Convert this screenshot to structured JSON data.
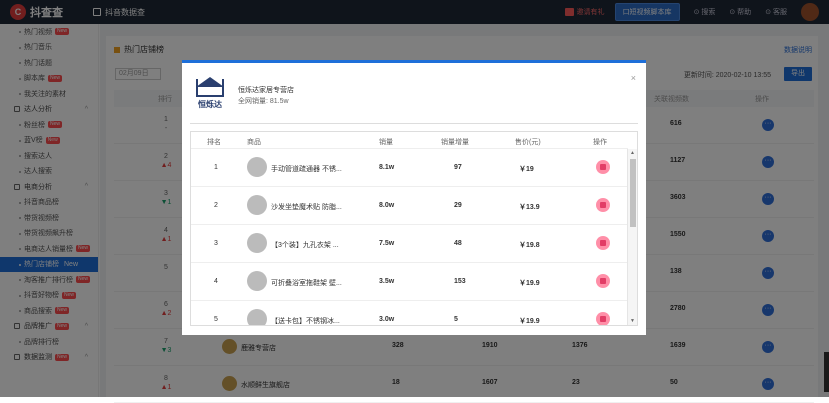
{
  "topbar": {
    "logo_badge": "C",
    "logo_text": "抖查查",
    "app_name": "抖音数据查",
    "invite": "邀请有礼",
    "video_btn": "口短视频脚本库",
    "search": "⊙ 搜索",
    "help": "⊙ 帮助",
    "service": "⊙ 客服"
  },
  "sidebar": {
    "items": [
      {
        "label": "热门视频",
        "type": "item",
        "new": true
      },
      {
        "label": "热门音乐",
        "type": "item"
      },
      {
        "label": "热门话题",
        "type": "item"
      },
      {
        "label": "脚本库",
        "type": "item",
        "new": true
      },
      {
        "label": "我关注的素材",
        "type": "item"
      },
      {
        "label": "达人分析",
        "type": "group"
      },
      {
        "label": "粉丝榜",
        "type": "item",
        "new": true
      },
      {
        "label": "蓝V榜",
        "type": "item",
        "new": true
      },
      {
        "label": "搜索达人",
        "type": "item"
      },
      {
        "label": "达人搜索",
        "type": "item"
      },
      {
        "label": "电商分析",
        "type": "group"
      },
      {
        "label": "抖音商品榜",
        "type": "item"
      },
      {
        "label": "带货视频榜",
        "type": "item"
      },
      {
        "label": "带货视频飙升榜",
        "type": "item"
      },
      {
        "label": "电商达人销量榜",
        "type": "item",
        "new": true
      },
      {
        "label": "热门店铺榜",
        "type": "item",
        "new": true,
        "active": true
      },
      {
        "label": "淘客推广排行榜",
        "type": "item",
        "new": true
      },
      {
        "label": "抖音好物榜",
        "type": "item",
        "new": true
      },
      {
        "label": "商品搜索",
        "type": "item",
        "new": true
      },
      {
        "label": "品牌推广",
        "type": "group",
        "new": true
      },
      {
        "label": "品牌排行榜",
        "type": "item"
      },
      {
        "label": "数据监测",
        "type": "group",
        "new": true
      }
    ],
    "new_label": "New"
  },
  "panel": {
    "title": "热门店铺榜",
    "explain": "数据说明",
    "date": "02月09日",
    "update_label": "更新时间: 2020-02-10 13:55",
    "export": "导出",
    "columns": {
      "rank": "排行",
      "videos": "关联视频数",
      "action": "操作"
    }
  },
  "bg_rows": [
    {
      "rank": "1",
      "change": "-",
      "dir": "none",
      "videos": "616"
    },
    {
      "rank": "2",
      "change": "▲4",
      "dir": "up",
      "videos": "1127"
    },
    {
      "rank": "3",
      "change": "▼1",
      "dir": "down",
      "videos": "3603"
    },
    {
      "rank": "4",
      "change": "▲1",
      "dir": "up",
      "videos": "1550"
    },
    {
      "rank": "5",
      "change": "",
      "dir": "none",
      "videos": "138"
    },
    {
      "rank": "6",
      "change": "▲2",
      "dir": "up",
      "videos": "2780"
    },
    {
      "rank": "7",
      "change": "▼3",
      "dir": "down",
      "shop": "鹿雅专营店",
      "a": "328",
      "b": "1910",
      "c": "1376",
      "videos": "1639"
    },
    {
      "rank": "8",
      "change": "▲1",
      "dir": "up",
      "shop": "水顺鲜生旗舰店",
      "a": "18",
      "b": "1607",
      "c": "23",
      "videos": "50"
    }
  ],
  "modal": {
    "brand": "恒烁达",
    "shop_name": "恒烁达家居专营店",
    "total_sales": "全网销量: 81.5w",
    "close": "×",
    "columns": [
      "排名",
      "商品",
      "销量",
      "销量增量",
      "售价(元)",
      "操作"
    ],
    "rows": [
      {
        "rank": "1",
        "name": "手动管道疏通器 不锈...",
        "sales": "8.1w",
        "inc": "97",
        "price": "￥19"
      },
      {
        "rank": "2",
        "name": "沙发坐垫魔术贴 防脂...",
        "sales": "8.0w",
        "inc": "29",
        "price": "￥13.9"
      },
      {
        "rank": "3",
        "name": "【3个装】九孔衣架 ...",
        "sales": "7.5w",
        "inc": "48",
        "price": "￥19.8"
      },
      {
        "rank": "4",
        "name": "可折叠浴室拖鞋架 壁...",
        "sales": "3.5w",
        "inc": "153",
        "price": "￥19.9"
      },
      {
        "rank": "5",
        "name": "【送卡包】不锈钢冰...",
        "sales": "3.0w",
        "inc": "5",
        "price": "￥19.9"
      }
    ]
  }
}
